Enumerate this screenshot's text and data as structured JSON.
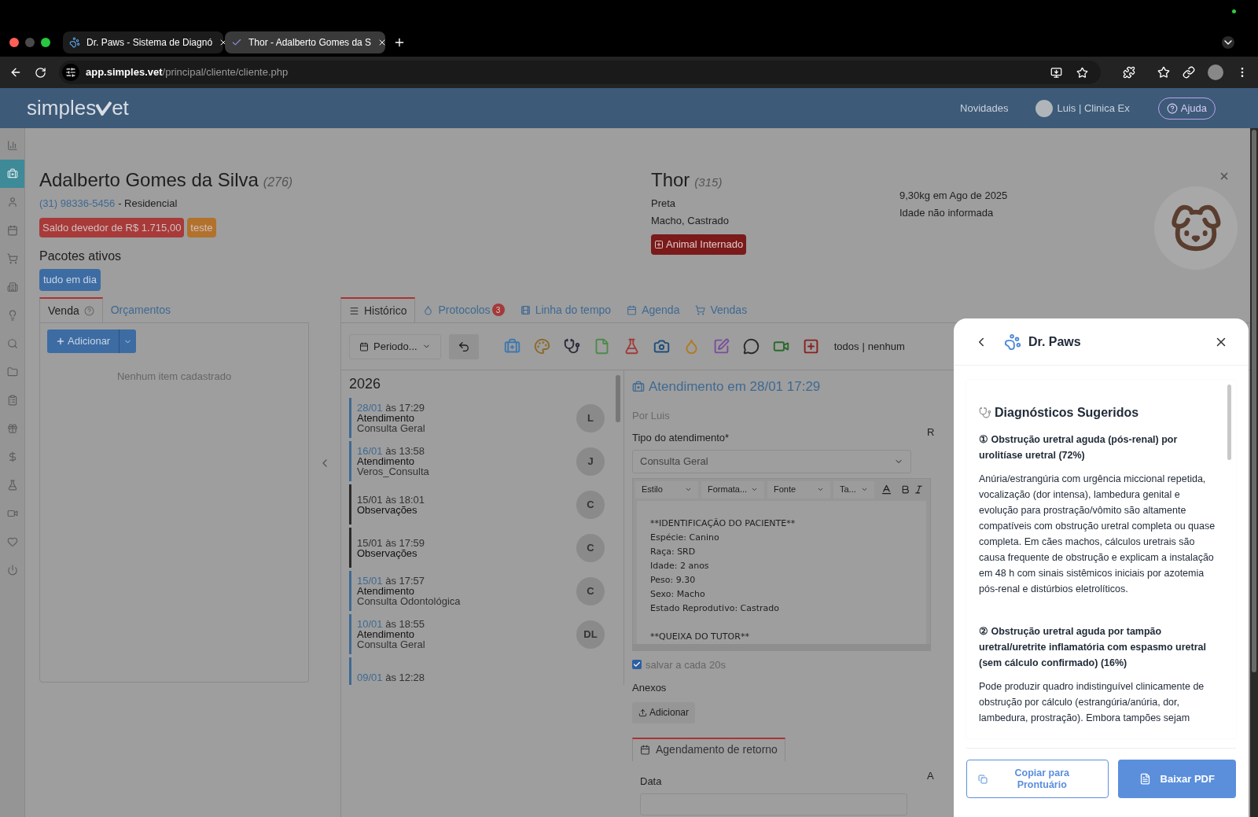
{
  "browser": {
    "tabs": [
      {
        "title": "Dr. Paws - Sistema de Diagnó",
        "selected": false,
        "kind": "paw"
      },
      {
        "title": "Thor - Adalberto Gomes da S",
        "selected": true,
        "kind": "vet"
      }
    ],
    "url_host": "app.simples.vet",
    "url_path": "/principal/cliente/cliente.php"
  },
  "header": {
    "logo_before": "simples",
    "logo_after": "et",
    "news": "Novidades",
    "user": "Luis | Clinica Ex",
    "help": "Ajuda"
  },
  "sidebar": {
    "items": [
      {
        "kind": "chart",
        "selected": false
      },
      {
        "kind": "medkit",
        "selected": true
      },
      {
        "kind": "user",
        "selected": false
      },
      {
        "kind": "calendar",
        "selected": false
      },
      {
        "kind": "cart",
        "selected": false
      },
      {
        "kind": "building",
        "selected": false
      },
      {
        "kind": "bulb",
        "selected": false
      },
      {
        "kind": "search",
        "selected": false
      },
      {
        "kind": "folder",
        "selected": false
      },
      {
        "kind": "clipboard",
        "selected": false
      },
      {
        "kind": "gift",
        "selected": false
      },
      {
        "kind": "dollar",
        "selected": false
      },
      {
        "kind": "flask",
        "selected": false
      },
      {
        "kind": "video",
        "selected": false
      },
      {
        "kind": "heart",
        "selected": false
      },
      {
        "kind": "power",
        "selected": false
      }
    ]
  },
  "client": {
    "name": "Adalberto Gomes da Silva",
    "id": "(276)",
    "phone": "(31) 98336-5456",
    "phone_type": "- Residencial",
    "badges": [
      {
        "text": "Saldo devedor de R$ 1.715,00",
        "color": "#a83a3a"
      },
      {
        "text": "teste",
        "color": "#b2722c"
      }
    ],
    "packages_title": "Pacotes ativos",
    "packages": [
      {
        "text": "tudo em dia",
        "color": "#3d6ca3"
      }
    ]
  },
  "pet": {
    "name": "Thor",
    "id": "(315)",
    "coat": "Preta",
    "sex": "Macho, Castrado",
    "weight": "9,30kg em Ago de 2025",
    "age": "Idade não informada",
    "status": "Animal Internado"
  },
  "sale": {
    "tabs": [
      {
        "label": "Venda",
        "selected": true
      },
      {
        "label": "Orçamentos",
        "selected": false
      }
    ],
    "add_button": "Adicionar",
    "empty": "Nenhum item cadastrado"
  },
  "history_tabs": [
    {
      "label": "Histórico",
      "kind": "list",
      "selected": true
    },
    {
      "label": "Protocolos",
      "kind": "drop",
      "selected": false,
      "badge": "3"
    },
    {
      "label": "Linha do tempo",
      "kind": "film",
      "selected": false
    },
    {
      "label": "Agenda",
      "kind": "calendar",
      "selected": false
    },
    {
      "label": "Vendas",
      "kind": "cart",
      "selected": false
    }
  ],
  "toolbar": {
    "period": "Periodo...",
    "filters": [
      {
        "kind": "medkit",
        "color": "#3f78b0"
      },
      {
        "kind": "palette",
        "color": "#8a6a2a"
      },
      {
        "kind": "stethoscope",
        "color": "#2a2a3a"
      },
      {
        "kind": "file",
        "color": "#4f8a4a"
      },
      {
        "kind": "flask",
        "color": "#a33a3a"
      },
      {
        "kind": "camera",
        "color": "#1f4f7a"
      },
      {
        "kind": "drop",
        "color": "#b07a20"
      },
      {
        "kind": "edit",
        "color": "#7a4f9a"
      },
      {
        "kind": "comment",
        "color": "#2a2a2a"
      },
      {
        "kind": "video",
        "color": "#2a6a2a"
      },
      {
        "kind": "plus",
        "color": "#8a2020"
      }
    ],
    "links": [
      "todos",
      "nenhum"
    ],
    "separator": "|"
  },
  "timeline": {
    "year": "2026",
    "items": [
      {
        "date": "28/01",
        "time": "às 17:29",
        "kind": "atendimento",
        "title": "Atendimento",
        "subtitle": "Consulta Geral",
        "initials": "L"
      },
      {
        "date": "16/01",
        "time": "às 13:58",
        "kind": "atendimento",
        "title": "Atendimento",
        "subtitle": "Veros_Consulta",
        "initials": "J"
      },
      {
        "date": "15/01",
        "time": "às 18:01",
        "kind": "observacao",
        "title": "Observações",
        "initials": "C"
      },
      {
        "date": "15/01",
        "time": "às 17:59",
        "kind": "observacao",
        "title": "Observações",
        "initials": "C"
      },
      {
        "date": "15/01",
        "time": "às 17:57",
        "kind": "atendimento",
        "title": "Atendimento",
        "subtitle": "Consulta Odontológica",
        "initials": "C"
      },
      {
        "date": "10/01",
        "time": "às 18:55",
        "kind": "atendimento",
        "title": "Atendimento",
        "subtitle": "Consulta Geral",
        "initials": "DL"
      },
      {
        "date": "09/01",
        "time": "às 12:28",
        "kind": "atendimento"
      }
    ]
  },
  "record": {
    "title": "Atendimento em 28/01 17:29",
    "by": "Por Luis",
    "type_label": "Tipo do atendimento*",
    "type_value": "Consulta Geral",
    "editor_menus": [
      "Estilo",
      "Formata...",
      "Fonte",
      "Ta..."
    ],
    "editor_sections": [
      [
        "**IDENTIFICAÇÃO DO PACIENTE**",
        "Espécie: Canino",
        "Raça: SRD",
        "Idade: 2 anos",
        "Peso: 9.30",
        "Sexo: Macho",
        "Estado Reprodutivo: Castrado"
      ],
      [
        "**QUEIXA DO TUTOR**"
      ]
    ],
    "autosave": {
      "label": "salvar a cada 20s",
      "checked": true
    },
    "attachments_label": "Anexos",
    "attach_button": "Adicionar",
    "return_tab": "Agendamento de retorno",
    "date_label": "Data",
    "side_labels": [
      "R",
      "A"
    ]
  },
  "panel": {
    "title": "Dr. Paws",
    "section_title": "Diagnósticos Sugeridos",
    "diagnoses": [
      {
        "marker": "①",
        "title": "Obstrução uretral aguda (pós-renal) por urolitíase uretral (72%)",
        "text": "Anúria/estrangúria com urgência miccional repetida, vocalização (dor intensa), lambedura genital e evolução para prostração/vômito são altamente compatíveis com obstrução uretral completa ou quase completa. Em cães machos, cálculos uretrais são causa frequente de obstrução e explicam a instalação em 48 h com sinais sistêmicos iniciais por azotemia pós-renal e distúrbios eletrolíticos."
      },
      {
        "marker": "②",
        "title": "Obstrução uretral aguda por tampão uretral/uretrite inflamatória com espasmo uretral (sem cálculo confirmado) (16%)",
        "text": "Pode produzir quadro indistinguível clinicamente de obstrução por cálculo (estrangúria/anúria, dor, lambedura, prostração). Embora tampões sejam"
      }
    ],
    "copy_button": "Copiar para Prontuário",
    "pdf_button": "Baixar PDF"
  }
}
